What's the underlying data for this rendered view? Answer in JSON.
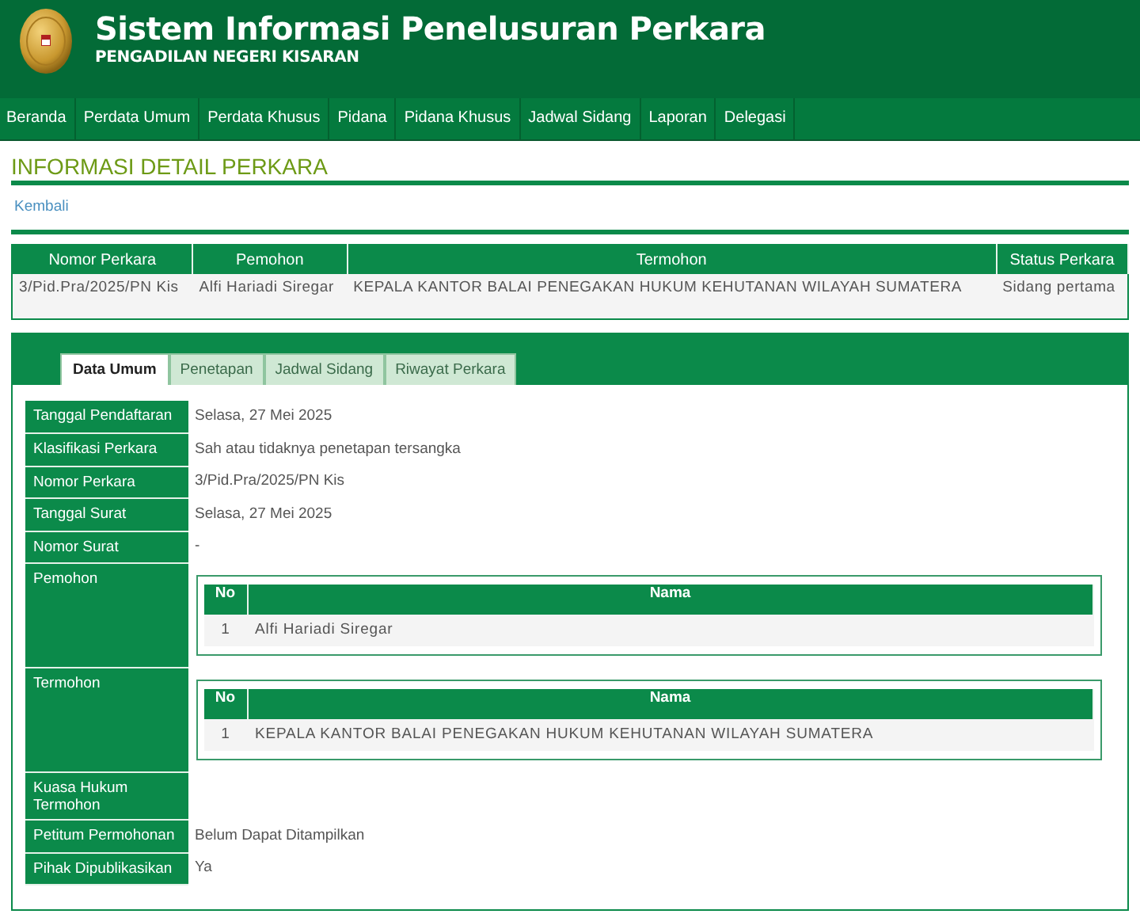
{
  "header": {
    "title": "Sistem Informasi Penelusuran Perkara",
    "subtitle": "PENGADILAN NEGERI KISARAN"
  },
  "nav": [
    {
      "label": "Beranda"
    },
    {
      "label": "Perdata Umum"
    },
    {
      "label": "Perdata Khusus"
    },
    {
      "label": "Pidana"
    },
    {
      "label": "Pidana Khusus"
    },
    {
      "label": "Jadwal Sidang"
    },
    {
      "label": "Laporan"
    },
    {
      "label": "Delegasi"
    }
  ],
  "page_title": "INFORMASI DETAIL PERKARA",
  "back_link": "Kembali",
  "summary": {
    "columns": [
      "Nomor Perkara",
      "Pemohon",
      "Termohon",
      "Status Perkara"
    ],
    "rows": [
      [
        "3/Pid.Pra/2025/PN Kis",
        "Alfi Hariadi Siregar",
        "KEPALA KANTOR BALAI PENEGAKAN HUKUM KEHUTANAN WILAYAH SUMATERA",
        "Sidang pertama"
      ]
    ]
  },
  "tabs": [
    {
      "label": "Data Umum",
      "selected": true
    },
    {
      "label": "Penetapan",
      "selected": false
    },
    {
      "label": "Jadwal Sidang",
      "selected": false
    },
    {
      "label": "Riwayat Perkara",
      "selected": false
    }
  ],
  "details": [
    {
      "kind": "text",
      "label": "Tanggal Pendaftaran",
      "value": "Selasa, 27 Mei 2025"
    },
    {
      "kind": "text",
      "label": "Klasifikasi Perkara",
      "value": "Sah atau tidaknya penetapan tersangka"
    },
    {
      "kind": "text",
      "label": "Nomor Perkara",
      "value": "3/Pid.Pra/2025/PN Kis"
    },
    {
      "kind": "text",
      "label": "Tanggal Surat",
      "value": "Selasa, 27 Mei 2025"
    },
    {
      "kind": "text",
      "label": "Nomor Surat",
      "value": "-"
    },
    {
      "kind": "parties",
      "label": "Pemohon",
      "columns": [
        "No",
        "Nama"
      ],
      "rows": [
        [
          "1",
          "Alfi Hariadi Siregar"
        ]
      ]
    },
    {
      "kind": "parties",
      "label": "Termohon",
      "columns": [
        "No",
        "Nama"
      ],
      "rows": [
        [
          "1",
          "KEPALA KANTOR BALAI PENEGAKAN HUKUM KEHUTANAN WILAYAH SUMATERA"
        ]
      ]
    },
    {
      "kind": "text",
      "label": "Kuasa Hukum Termohon"
    },
    {
      "kind": "text",
      "label": "Petitum Permohonan",
      "value": "Belum Dapat Ditampilkan"
    },
    {
      "kind": "text",
      "label": "Pihak Dipublikasikan",
      "value": "Ya"
    }
  ]
}
